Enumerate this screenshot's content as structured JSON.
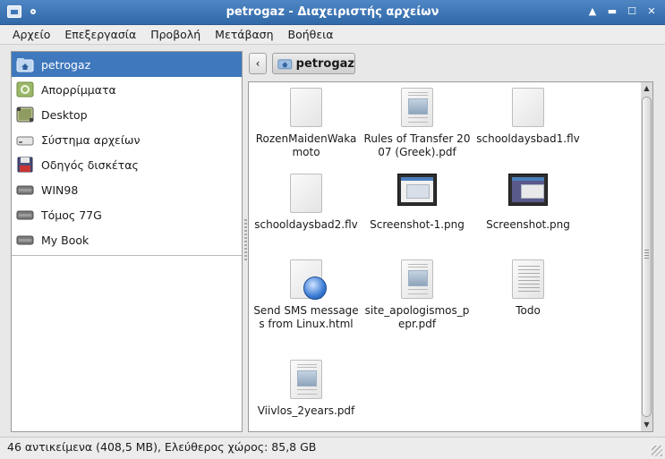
{
  "window": {
    "title": "petrogaz - Διαχειριστής αρχείων"
  },
  "menu": [
    "Αρχείο",
    "Επεξεργασία",
    "Προβολή",
    "Μετάβαση",
    "Βοήθεια"
  ],
  "sidebar": {
    "items": [
      {
        "label": "petrogaz",
        "icon": "home-folder-icon",
        "selected": true
      },
      {
        "label": "Απορρίμματα",
        "icon": "trash-icon",
        "selected": false
      },
      {
        "label": "Desktop",
        "icon": "desktop-icon",
        "selected": false
      },
      {
        "label": "Σύστημα αρχείων",
        "icon": "drive-icon",
        "selected": false
      },
      {
        "label": "Οδηγός δισκέτας",
        "icon": "floppy-icon",
        "selected": false
      },
      {
        "label": "WIN98",
        "icon": "drive-icon",
        "selected": false
      },
      {
        "label": "Τόμος 77G",
        "icon": "drive-icon",
        "selected": false
      },
      {
        "label": "My Book",
        "icon": "drive-icon",
        "selected": false
      }
    ]
  },
  "pathbar": {
    "current": "petrogaz"
  },
  "files": [
    {
      "name": "RozenMaidenWakamoto",
      "type": "blank"
    },
    {
      "name": "Rules of Transfer 2007 (Greek).pdf",
      "type": "pdf"
    },
    {
      "name": "schooldaysbad1.flv",
      "type": "blank"
    },
    {
      "name": "schooldaysbad2.flv",
      "type": "blank"
    },
    {
      "name": "Screenshot-1.png",
      "type": "screenshot"
    },
    {
      "name": "Screenshot.png",
      "type": "screenshot2"
    },
    {
      "name": "Send SMS messages from Linux.html",
      "type": "html"
    },
    {
      "name": "site_apologismos_pepr.pdf",
      "type": "pdf"
    },
    {
      "name": "Todo",
      "type": "text"
    },
    {
      "name": "Viivlos_2years.pdf",
      "type": "pdf"
    }
  ],
  "status": {
    "text": "46 αντικείμενα (408,5 MB), Ελεύθερος χώρος: 85,8 GB"
  },
  "colors": {
    "titlebar": "#3e78b9",
    "selection": "#3f78bd"
  }
}
